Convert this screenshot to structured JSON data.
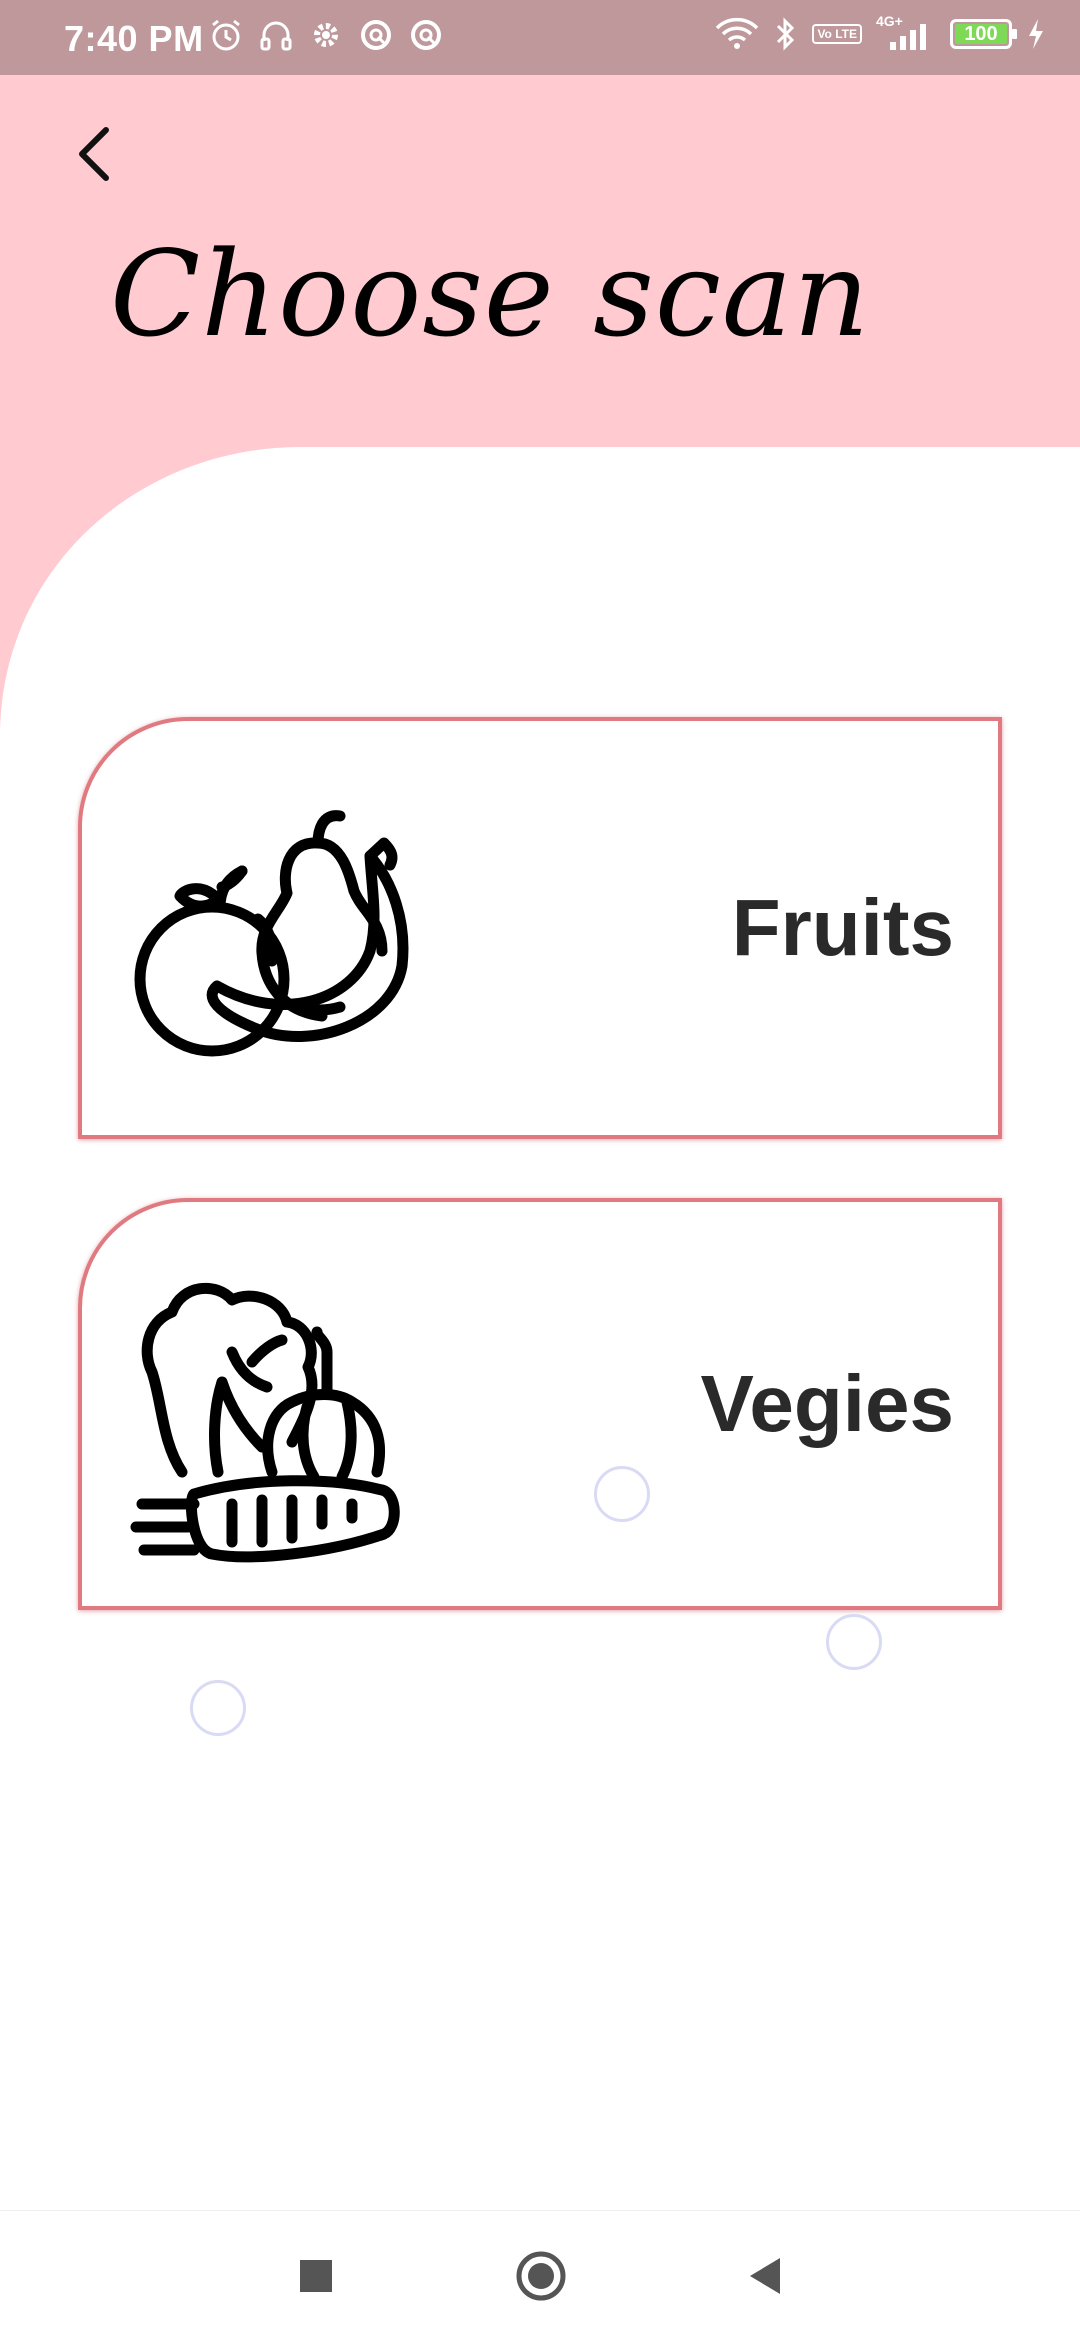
{
  "status_bar": {
    "time": "7:40 PM",
    "left_icons": [
      "alarm-icon",
      "headset-icon",
      "settings-icon",
      "app-notification-icon",
      "app-notification-icon"
    ],
    "network": "4G+",
    "volte": "Vo LTE",
    "battery_level": "100",
    "charging": true
  },
  "header": {
    "back_icon": "chevron-left-icon",
    "title": "Choose scan",
    "background": "#ffcad0"
  },
  "options": [
    {
      "label": "Fruits",
      "icon": "fruits-icon"
    },
    {
      "label": "Vegies",
      "icon": "vegetables-icon"
    }
  ],
  "nav_bar": {
    "buttons": [
      "recents-button",
      "home-button",
      "back-button"
    ]
  },
  "colors": {
    "status_bar": "#bf989b",
    "card_border": "#e07a80",
    "battery": "#7ed957"
  }
}
